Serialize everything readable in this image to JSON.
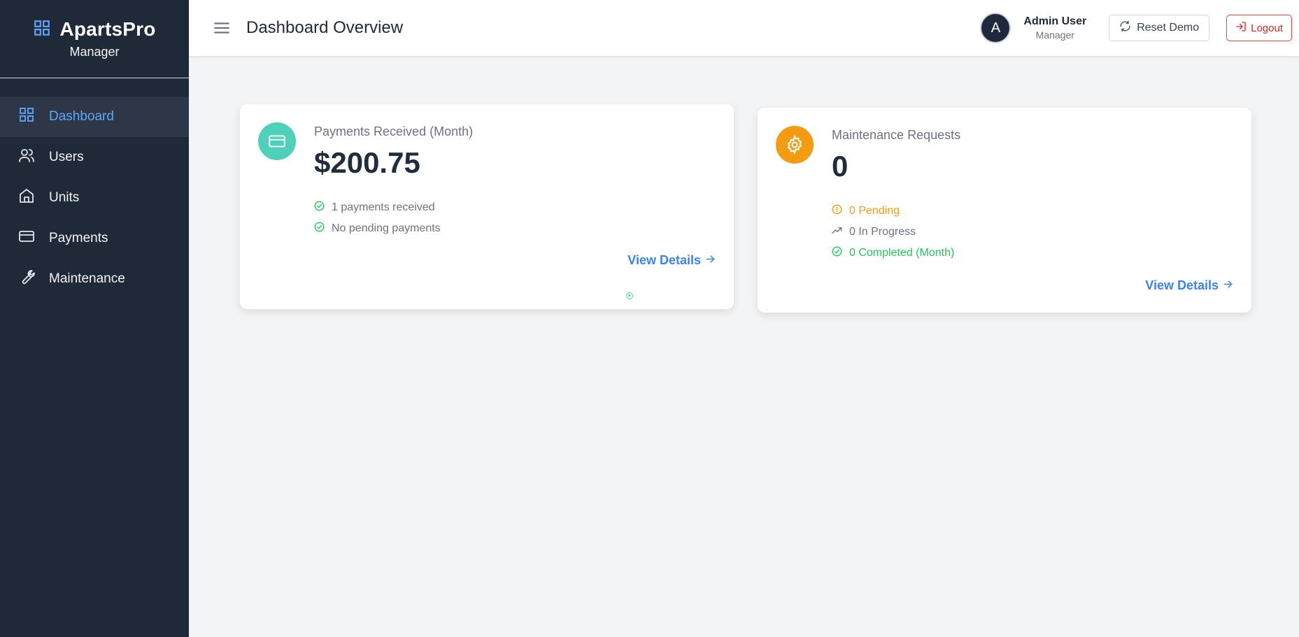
{
  "sidebar": {
    "brand_title": "ApartsPro",
    "brand_subtitle": "Manager",
    "items": [
      {
        "label": "Dashboard",
        "icon": "grid-icon",
        "active": true
      },
      {
        "label": "Users",
        "icon": "users-icon"
      },
      {
        "label": "Units",
        "icon": "home-icon"
      },
      {
        "label": "Payments",
        "icon": "credit-card-icon"
      },
      {
        "label": "Maintenance",
        "icon": "wrench-icon"
      }
    ]
  },
  "header": {
    "title": "Dashboard Overview",
    "avatar_initial": "A",
    "user_name": "Admin User",
    "user_role": "Manager",
    "reset_label": "Reset Demo",
    "logout_label": "Logout"
  },
  "cards": {
    "payments": {
      "label": "Payments Received (Month)",
      "value": "$200.75",
      "stats": [
        "1 payments received",
        "No pending payments"
      ],
      "link": "View Details",
      "icon": "credit-card-icon",
      "icon_color": "#4fd1b9"
    },
    "maintenance": {
      "label": "Maintenance Requests",
      "value": "0",
      "stats": [
        "0 Pending",
        "0 In Progress",
        "0 Completed (Month)"
      ],
      "link": "View Details",
      "icon": "gear-icon",
      "icon_color": "#f39c12"
    }
  },
  "colors": {
    "sidebar_bg": "#1f2937",
    "accent": "#3b82f6",
    "success": "#22c55e",
    "warning": "#f39c12",
    "danger": "#dc2626"
  }
}
